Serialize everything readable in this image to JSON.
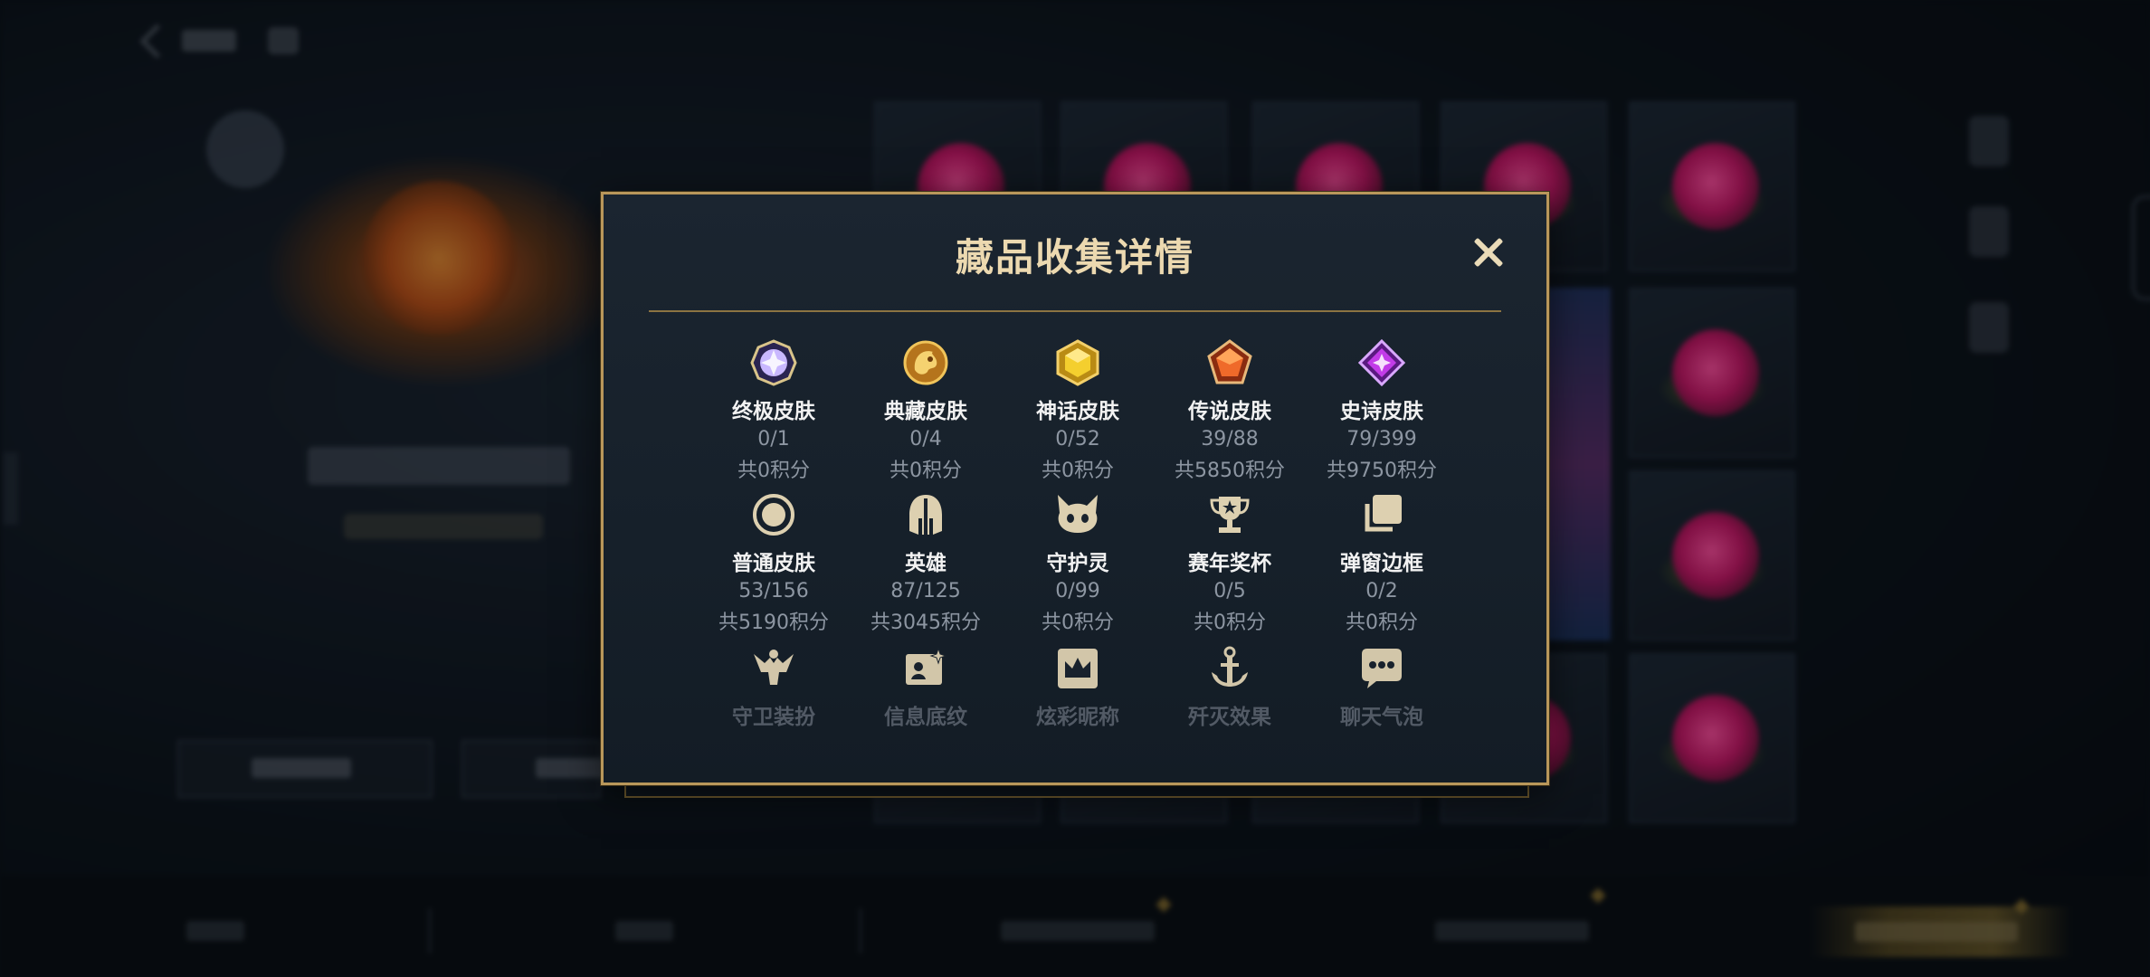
{
  "modal": {
    "title": "藏品收集详情",
    "close_label": "×",
    "rows": [
      [
        {
          "label": "终极皮肤",
          "count": "0/1",
          "points": "共0积分",
          "icon": "ultimate-skin-icon",
          "color": "#b9a6ff"
        },
        {
          "label": "典藏皮肤",
          "count": "0/4",
          "points": "共0积分",
          "icon": "collector-skin-icon",
          "color": "#e6a22a"
        },
        {
          "label": "神话皮肤",
          "count": "0/52",
          "points": "共0积分",
          "icon": "mythic-skin-icon",
          "color": "#e6b422"
        },
        {
          "label": "传说皮肤",
          "count": "39/88",
          "points": "共5850积分",
          "icon": "legendary-skin-icon",
          "color": "#e0561e"
        },
        {
          "label": "史诗皮肤",
          "count": "79/399",
          "points": "共9750积分",
          "icon": "epic-skin-icon",
          "color": "#b63bd8"
        }
      ],
      [
        {
          "label": "普通皮肤",
          "count": "53/156",
          "points": "共5190积分",
          "icon": "normal-skin-icon",
          "color": "#d8c8a6"
        },
        {
          "label": "英雄",
          "count": "87/125",
          "points": "共3045积分",
          "icon": "hero-helmet-icon",
          "color": "#d8c8a6"
        },
        {
          "label": "守护灵",
          "count": "0/99",
          "points": "共0积分",
          "icon": "guardian-spirit-icon",
          "color": "#d8c8a6"
        },
        {
          "label": "赛年奖杯",
          "count": "0/5",
          "points": "共0积分",
          "icon": "trophy-icon",
          "color": "#d8c8a6"
        },
        {
          "label": "弹窗边框",
          "count": "0/2",
          "points": "共0积分",
          "icon": "popup-frame-icon",
          "color": "#d8c8a6"
        }
      ],
      [
        {
          "label": "守卫装扮",
          "icon": "guardian-outfit-icon",
          "color": "#d8c8a6"
        },
        {
          "label": "信息底纹",
          "icon": "info-card-icon",
          "color": "#d8c8a6"
        },
        {
          "label": "炫彩昵称",
          "icon": "crown-name-icon",
          "color": "#d8c8a6"
        },
        {
          "label": "歼灭效果",
          "icon": "anchor-effect-icon",
          "color": "#d8c8a6"
        },
        {
          "label": "聊天气泡",
          "icon": "chat-bubble-icon",
          "color": "#d8c8a6"
        }
      ]
    ]
  },
  "colors": {
    "gold_border": "#b9975a",
    "title_text": "#ecd9b0",
    "muted_text": "#8d96a2"
  }
}
